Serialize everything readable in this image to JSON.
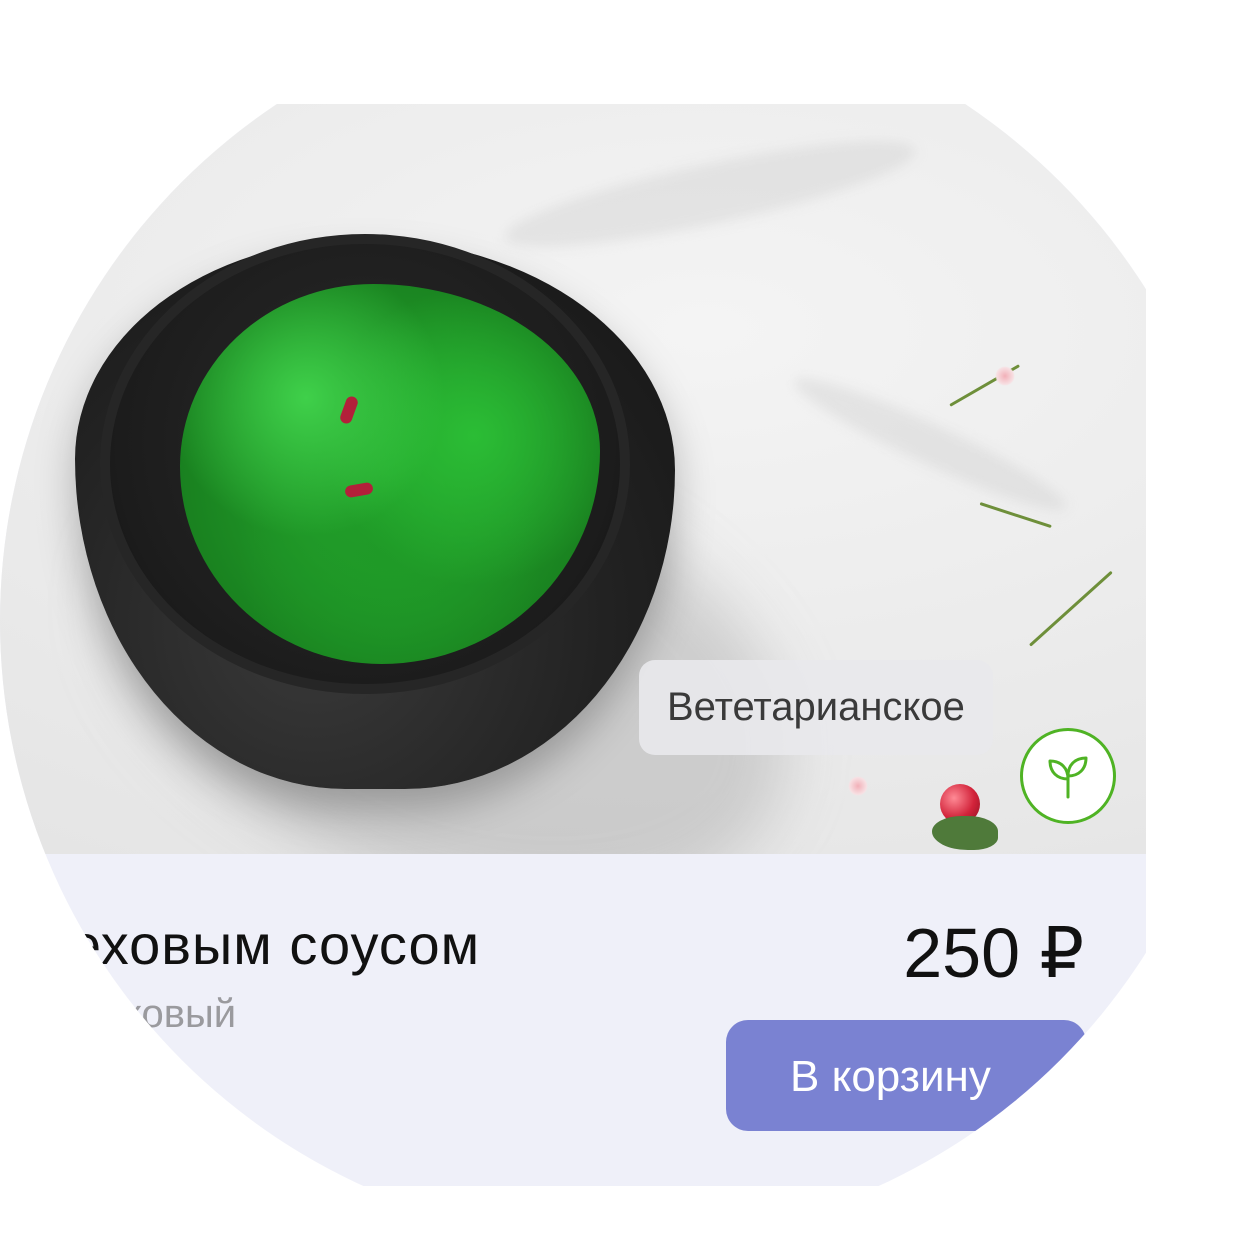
{
  "product": {
    "title": "с ореховым соусом",
    "subtitle": "с ореховый",
    "price": "250 ₽",
    "tag_label": "Вететарианское",
    "badge_icon": "leaf-sprout-icon",
    "cart_button_label": "В корзину",
    "image_alt": "chuka-salad-photo"
  },
  "colors": {
    "card_background": "#eff0f9",
    "button_background": "#7a82d2",
    "badge_accent": "#4fb324",
    "title_text": "#111111",
    "subtitle_text": "#9a9a9e"
  }
}
